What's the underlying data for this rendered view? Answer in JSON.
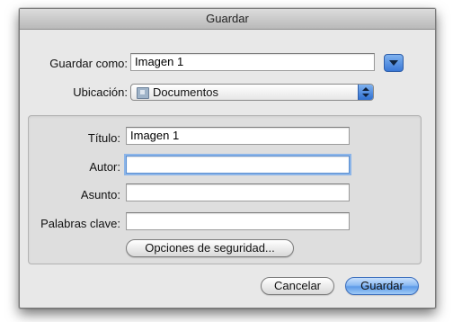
{
  "dialog": {
    "title": "Guardar"
  },
  "save_as": {
    "label": "Guardar como:",
    "value": "Imagen 1"
  },
  "location": {
    "label": "Ubicación:",
    "value": "Documentos"
  },
  "metadata": {
    "title_label": "Título:",
    "title_value": "Imagen 1",
    "author_label": "Autor:",
    "author_value": "",
    "subject_label": "Asunto:",
    "subject_value": "",
    "keywords_label": "Palabras clave:",
    "keywords_value": "",
    "security_button": "Opciones de seguridad..."
  },
  "buttons": {
    "cancel": "Cancelar",
    "save": "Guardar"
  },
  "icons": {
    "disclosure": "chevron-down-icon",
    "folder": "folder-icon",
    "popup_arrows": "updown-arrows-icon"
  },
  "colors": {
    "accent": "#5e9be8",
    "focus_ring": "#8cb5e8"
  }
}
